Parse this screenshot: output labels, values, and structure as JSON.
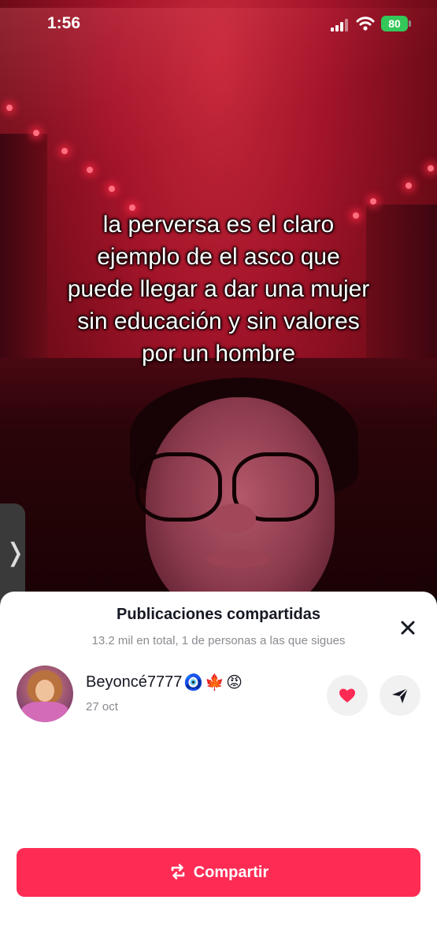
{
  "status_bar": {
    "time": "1:56",
    "battery": "80"
  },
  "video": {
    "caption_lines": [
      "la perversa es el claro",
      "ejemplo de el asco que",
      "puede llegar a dar una mujer",
      "sin educación y sin valores",
      "por un hombre"
    ]
  },
  "sheet": {
    "title": "Publicaciones compartidas",
    "subtitle": "13.2 mil en total, 1 de personas a las que sigues",
    "close_icon": "close-icon"
  },
  "shares": [
    {
      "username": "Beyoncé7777",
      "emojis": [
        "🧿",
        "🍁",
        "😡"
      ],
      "date": "27 oct"
    }
  ],
  "share_button": {
    "label": "Compartir",
    "icon": "repost-icon"
  },
  "colors": {
    "accent": "#fe2c55",
    "battery": "#34c759"
  }
}
